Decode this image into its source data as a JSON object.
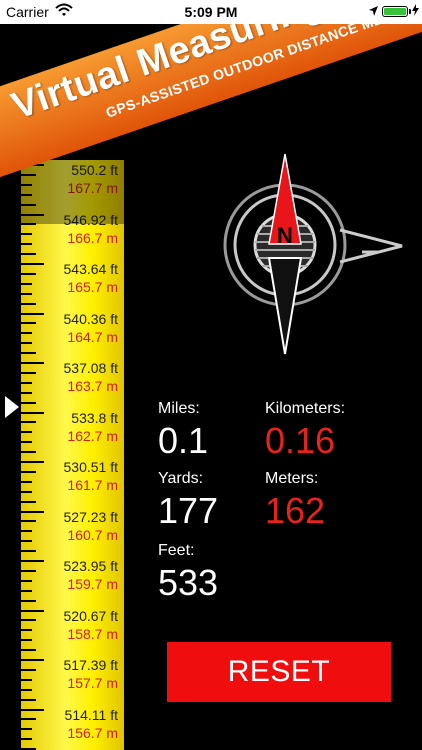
{
  "status_bar": {
    "carrier": "Carrier",
    "time": "5:09 PM",
    "battery_color": "#38c23a"
  },
  "banner": {
    "title": "Virtual Measuring Tape",
    "subtitle": "GPS-ASSISTED OUTDOOR DISTANCE MEASUREMENT TOOL"
  },
  "tape": {
    "marks": [
      {
        "ft": "550.2 ft",
        "m": "167.7 m"
      },
      {
        "ft": "546.92 ft",
        "m": "166.7 m"
      },
      {
        "ft": "543.64 ft",
        "m": "165.7 m"
      },
      {
        "ft": "540.36 ft",
        "m": "164.7 m"
      },
      {
        "ft": "537.08 ft",
        "m": "163.7 m"
      },
      {
        "ft": "533.8 ft",
        "m": "162.7 m"
      },
      {
        "ft": "530.51 ft",
        "m": "161.7 m"
      },
      {
        "ft": "527.23 ft",
        "m": "160.7 m"
      },
      {
        "ft": "523.95 ft",
        "m": "159.7 m"
      },
      {
        "ft": "520.67 ft",
        "m": "158.7 m"
      },
      {
        "ft": "517.39 ft",
        "m": "157.7 m"
      },
      {
        "ft": "514.11 ft",
        "m": "156.7 m"
      }
    ]
  },
  "compass": {
    "north_label": "N",
    "needle_color": "#e8151b"
  },
  "readouts": {
    "miles_label": "Miles:",
    "miles_value": "0.1",
    "km_label": "Kilometers:",
    "km_value": "0.16",
    "yards_label": "Yards:",
    "yards_value": "177",
    "meters_label": "Meters:",
    "meters_value": "162",
    "feet_label": "Feet:",
    "feet_value": "533"
  },
  "reset_label": "RESET",
  "colors": {
    "accent_red": "#e8231c",
    "banner_orange": "#f07a1e",
    "tape_yellow": "#fff000"
  }
}
